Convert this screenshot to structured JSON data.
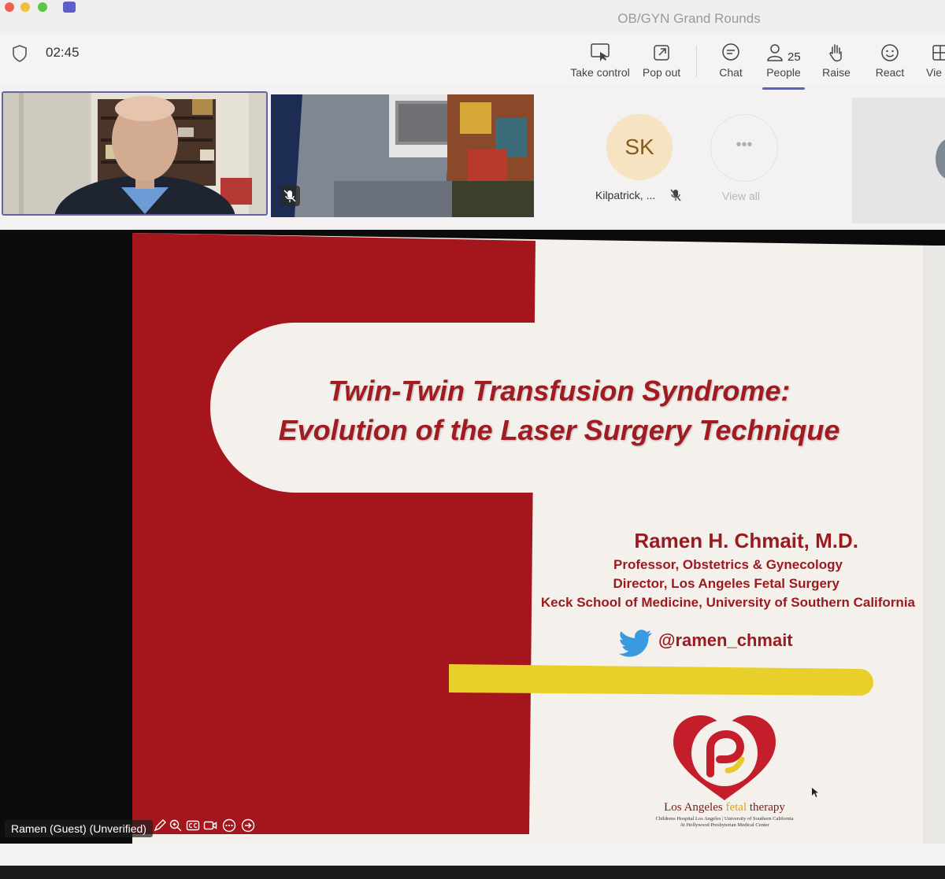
{
  "window": {
    "title": "OB/GYN Grand Rounds"
  },
  "toolbar": {
    "timer": "02:45",
    "buttons": {
      "take_control": "Take control",
      "pop_out": "Pop out",
      "chat": "Chat",
      "people": "People",
      "people_count": "25",
      "raise": "Raise",
      "react": "React",
      "view": "Vie"
    }
  },
  "participants": {
    "sk_initials": "SK",
    "sk_name": "Kilpatrick, ...",
    "view_all_label": "View all",
    "view_all_glyph": "•••"
  },
  "slide": {
    "title_line1": "Twin-Twin Transfusion Syndrome:",
    "title_line2": "Evolution of the Laser Surgery Technique",
    "author": "Ramen H. Chmait, M.D.",
    "affiliation1": "Professor, Obstetrics & Gynecology",
    "affiliation2": "Director, Los Angeles Fetal Surgery",
    "affiliation3": "Keck School of Medicine, University of Southern California",
    "twitter_handle": "@ramen_chmait",
    "logo_name_part1": "Los Angeles ",
    "logo_name_part2": "fetal",
    "logo_name_part3": " therapy",
    "logo_sub1": "Childrens Hospital Los Angeles | University of Southern California",
    "logo_sub2": "At Hollywood Presbyterian Medical Center",
    "colors": {
      "red": "#a5161c",
      "yellow": "#e8cf2a",
      "cream": "#f4f1ec"
    }
  },
  "presenter": {
    "name_tag": "Ramen (Guest) (Unverified)"
  }
}
